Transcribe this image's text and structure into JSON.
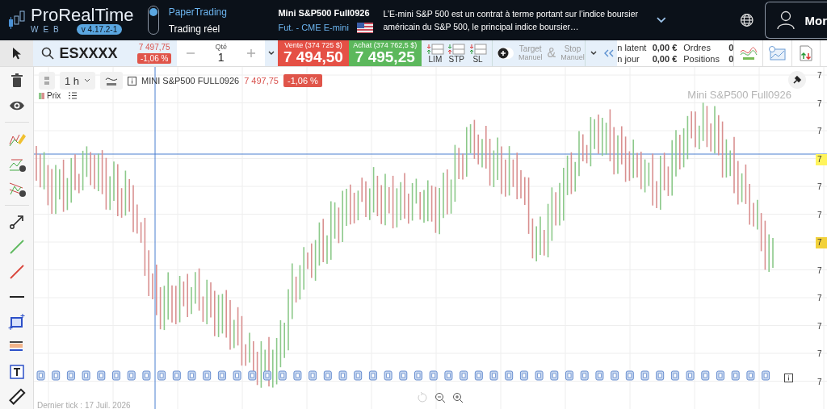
{
  "header": {
    "logo": "ProRealTime",
    "logo_sub": "WEB",
    "version": "v 4.17.2-1",
    "modes": [
      {
        "label": "PaperTrading",
        "selected": true
      },
      {
        "label": "Trading réel",
        "selected": false
      }
    ],
    "instrument": {
      "name": "Mini S&P500 Full0926",
      "market": "Fut. - CME E-mini",
      "description": "L’E-mini S&P 500 est un contrat à terme portant sur l’indice boursier américain du S&P 500, le principal indice boursier…"
    },
    "account": "Mor"
  },
  "toolbar": {
    "symbol": "ESXXXX",
    "last": "7 497,75",
    "change": "-1,06 %",
    "qty_label": "Qté",
    "qty": "1",
    "sell": {
      "label": "Vente (374 725 $)",
      "price": "7 494,50"
    },
    "buy": {
      "label": "Achat (374 762,5 $)",
      "price": "7 495,25"
    },
    "order_types": [
      "LIM",
      "STP",
      "SL"
    ],
    "auto_orders_on": false,
    "target": {
      "label": "Target",
      "mode": "Manuel"
    },
    "ampersand": "&",
    "stop": {
      "label": "Stop",
      "mode": "Manuel"
    },
    "pnl": [
      {
        "label": "n latent",
        "value": "0,00 €"
      },
      {
        "label": "n jour",
        "value": "0,00 €"
      }
    ],
    "counts": [
      {
        "label": "Ordres",
        "value": "0"
      },
      {
        "label": "Positions",
        "value": "0"
      }
    ]
  },
  "chart": {
    "interval": "1 h",
    "title": "MINI S&P500 FULL0926",
    "price": "7 497,75",
    "change": "-1,06 %",
    "legend": "Prix",
    "watermark": "Mini S&P500 Full0926",
    "axis": [
      {
        "text": "7",
        "kind": "tick"
      },
      {
        "text": "7",
        "kind": "tick"
      },
      {
        "text": "7",
        "kind": "tick"
      },
      {
        "text": "7",
        "kind": "cursor"
      },
      {
        "text": "7",
        "kind": "tick"
      },
      {
        "text": "7",
        "kind": "tick"
      },
      {
        "text": "7",
        "kind": "last"
      },
      {
        "text": "7",
        "kind": "tick"
      },
      {
        "text": "7",
        "kind": "tick"
      },
      {
        "text": "7",
        "kind": "tick"
      },
      {
        "text": "7",
        "kind": "tick"
      },
      {
        "text": "7",
        "kind": "tick"
      }
    ],
    "footer": "Dernier tick : 17 Juil. 2026"
  }
}
